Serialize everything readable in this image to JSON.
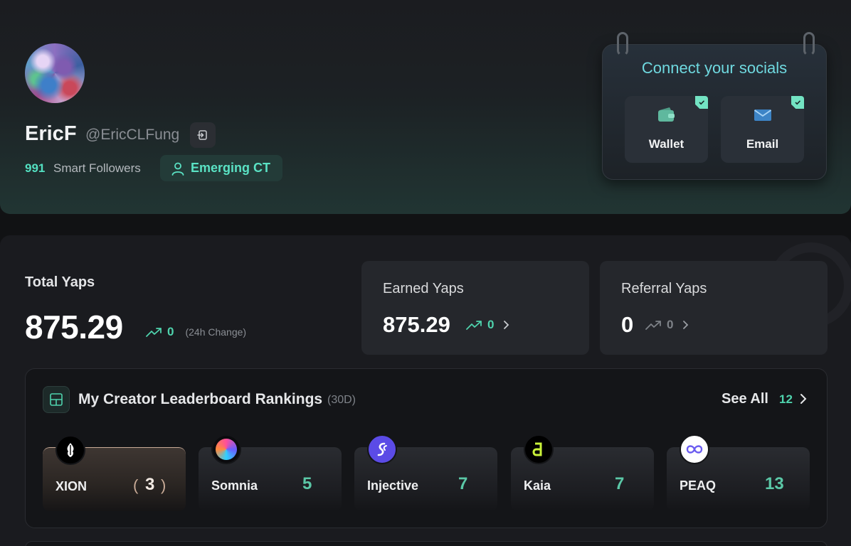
{
  "profile": {
    "name": "EricF",
    "handle": "@EricCLFung",
    "followers_count": "991",
    "followers_label": "Smart Followers",
    "badge": "Emerging CT"
  },
  "socials": {
    "title": "Connect your socials",
    "items": [
      {
        "label": "Wallet",
        "icon": "wallet-icon",
        "connected": true
      },
      {
        "label": "Email",
        "icon": "email-icon",
        "connected": true
      }
    ]
  },
  "yaps": {
    "total_label": "Total Yaps",
    "total_value": "875.29",
    "total_change": "0",
    "change_note": "(24h Change)",
    "earned_label": "Earned Yaps",
    "earned_value": "875.29",
    "earned_change": "0",
    "referral_label": "Referral Yaps",
    "referral_value": "0",
    "referral_change": "0"
  },
  "leaderboard": {
    "title": "My Creator Leaderboard Rankings",
    "period": "(30D)",
    "see_all": "See All",
    "count": "12",
    "items": [
      {
        "name": "XION",
        "rank": "3"
      },
      {
        "name": "Somnia",
        "rank": "5"
      },
      {
        "name": "Injective",
        "rank": "7"
      },
      {
        "name": "Kaia",
        "rank": "7"
      },
      {
        "name": "PEAQ",
        "rank": "13"
      }
    ]
  },
  "colors": {
    "accent": "#4fd3ad",
    "accent_light": "#5ae2c4",
    "socials_title": "#6fd9e0",
    "background": "#111214",
    "gold": "#c9ab97"
  }
}
